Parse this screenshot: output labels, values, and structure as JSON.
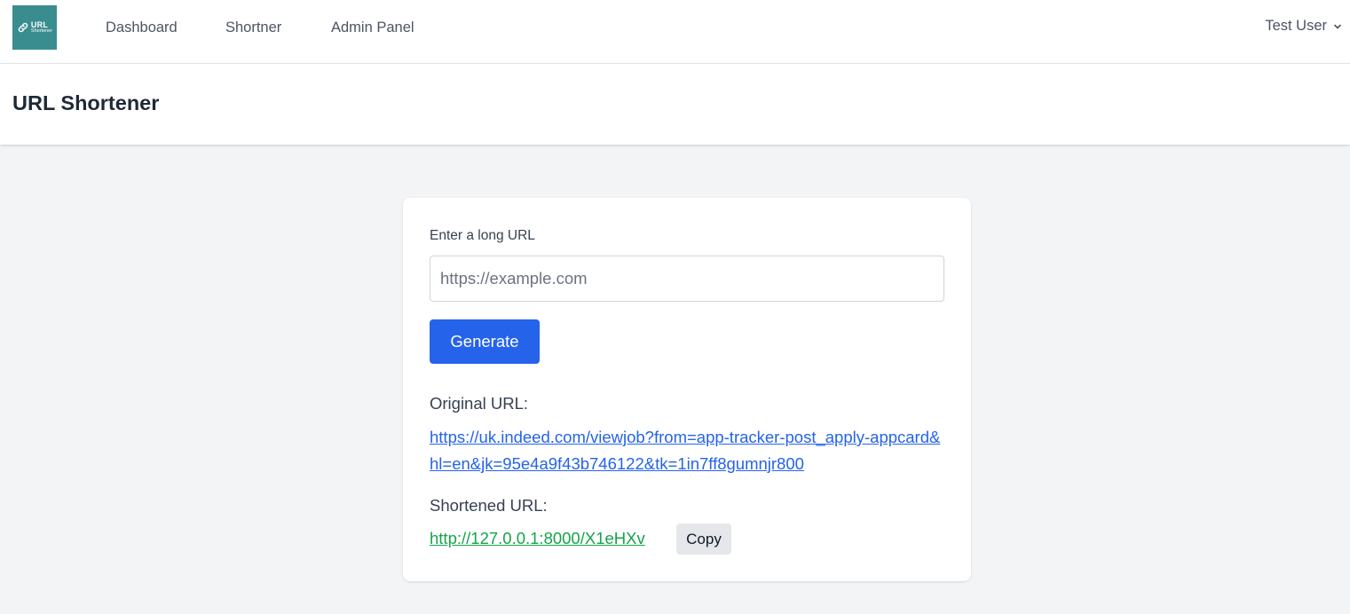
{
  "logo": {
    "line1": "URL",
    "line2": "Shortener",
    "icon": "link-icon"
  },
  "nav": {
    "items": [
      {
        "label": "Dashboard"
      },
      {
        "label": "Shortner"
      },
      {
        "label": "Admin Panel"
      }
    ],
    "user": {
      "name": "Test User",
      "icon": "chevron-down-icon"
    }
  },
  "header": {
    "title": "URL Shortener"
  },
  "form": {
    "label": "Enter a long URL",
    "input_value": "",
    "input_placeholder": "https://example.com",
    "generate_label": "Generate"
  },
  "result": {
    "original_label": "Original URL:",
    "original_url": "https://uk.indeed.com/viewjob?from=app-tracker-post_apply-appcard&hl=en&jk=95e4a9f43b746122&tk=1in7ff8gumnjr800",
    "shortened_label": "Shortened URL:",
    "shortened_url": "http://127.0.0.1:8000/X1eHXv",
    "copy_label": "Copy"
  },
  "colors": {
    "logo_bg": "#3a8d8f",
    "primary": "#2563eb",
    "link_blue": "#2563eb",
    "link_green": "#16a34a",
    "page_bg": "#f3f4f6"
  }
}
